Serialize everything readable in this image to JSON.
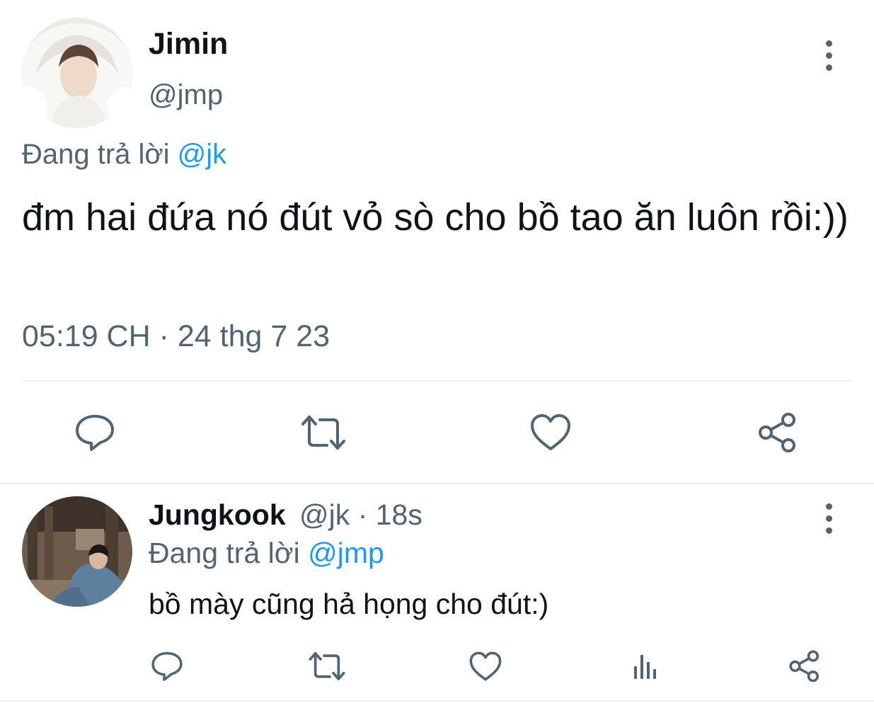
{
  "main_tweet": {
    "author_name": "Jimin",
    "handle": "@jmp",
    "reply_prefix": "Đang trả lời",
    "reply_to": "@jk",
    "text": "đm hai đứa nó đút vỏ sò cho bồ tao ăn luôn rồi:))",
    "timestamp": "05:19 CH · 24 thg 7 23",
    "actions": [
      "reply-icon",
      "retweet-icon",
      "like-icon",
      "share-icon"
    ]
  },
  "reply_tweet": {
    "author_name": "Jungkook",
    "handle": "@jk",
    "separator": "·",
    "time_ago": "18s",
    "reply_prefix": "Đang trả lời",
    "reply_to": "@jmp",
    "text": "bồ mày cũng hả họng cho đút:)",
    "actions": [
      "reply-icon",
      "retweet-icon",
      "like-icon",
      "analytics-icon",
      "share-icon"
    ]
  },
  "colors": {
    "text": "#0f1419",
    "muted": "#536471",
    "link": "#1d9bf0",
    "divider": "#eef1f3"
  }
}
